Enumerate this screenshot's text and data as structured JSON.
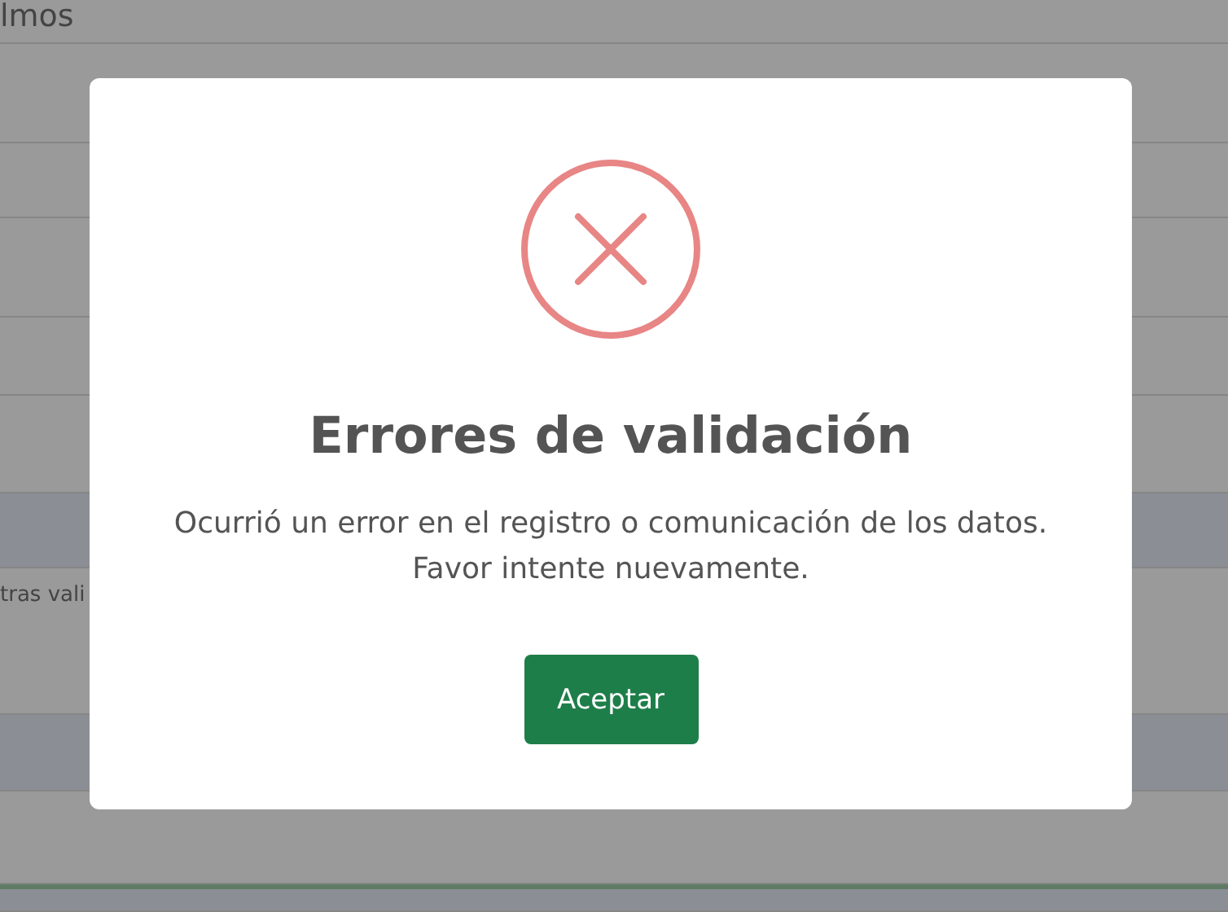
{
  "background_rows": [
    {
      "kind": "plain",
      "text": "lmos"
    },
    {
      "kind": "plain"
    },
    {
      "kind": "plain"
    },
    {
      "kind": "plain"
    },
    {
      "kind": "plain"
    },
    {
      "kind": "plain"
    },
    {
      "kind": "shaded"
    },
    {
      "kind": "plain",
      "text": "tras vali"
    },
    {
      "kind": "shaded"
    },
    {
      "kind": "plain"
    },
    {
      "kind": "footer"
    }
  ],
  "dialog": {
    "title": "Errores de validación",
    "message": [
      "Ocurrió un error en el registro o comunicación de los datos.",
      "Favor intente nuevamente."
    ],
    "button": "Aceptar"
  }
}
